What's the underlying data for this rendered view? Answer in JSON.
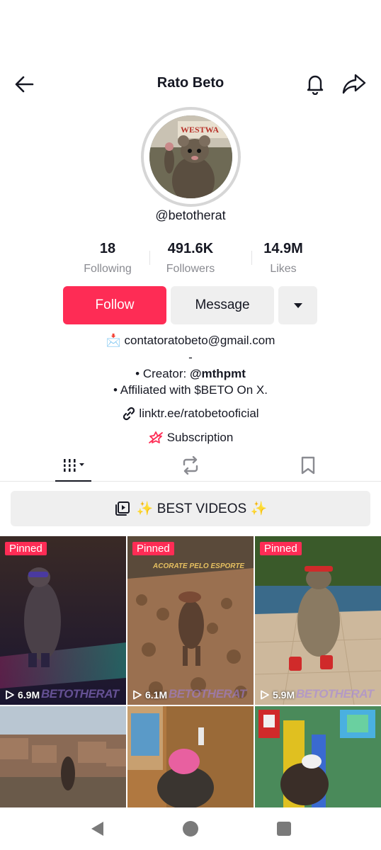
{
  "header": {
    "title": "Rato Beto"
  },
  "profile": {
    "handle": "@betotherat"
  },
  "stats": [
    {
      "value": "18",
      "label": "Following"
    },
    {
      "value": "491.6K",
      "label": "Followers"
    },
    {
      "value": "14.9M",
      "label": "Likes"
    }
  ],
  "actions": {
    "follow": "Follow",
    "message": "Message"
  },
  "bio": {
    "email_icon": "📩",
    "email": "contatoratobeto@gmail.com",
    "separator": "-",
    "creator_prefix": "• Creator: ",
    "creator_handle": "@mthpmt",
    "affiliation": "• Affiliated with $BETO On X.",
    "link": "linktr.ee/ratobetooficial",
    "subscription": "Subscription"
  },
  "playlist": {
    "label": "✨ BEST VIDEOS ✨"
  },
  "videos": [
    {
      "badge": "Pinned",
      "views": "6.9M",
      "watermark": "BETOTHERAT"
    },
    {
      "badge": "Pinned",
      "views": "6.1M",
      "watermark": "BETOTHERAT",
      "caption": "ACORATE PELO ESPORTE"
    },
    {
      "badge": "Pinned",
      "views": "5.9M",
      "watermark": "BETOTHERAT"
    },
    {},
    {},
    {}
  ],
  "colors": {
    "accent": "#fe2c55",
    "secondary_button": "#efefef",
    "text": "#161823",
    "muted": "#8a8b91"
  },
  "icons": {
    "back": "arrow-left-icon",
    "bell": "bell-icon",
    "share": "share-icon",
    "more": "caret-down-icon",
    "link": "link-icon",
    "subscription": "subscription-icon",
    "videos_tab": "videos-grid-icon",
    "reposts_tab": "repost-icon",
    "saved_tab": "bookmark-icon",
    "playlist": "playlist-icon",
    "play": "play-icon"
  }
}
